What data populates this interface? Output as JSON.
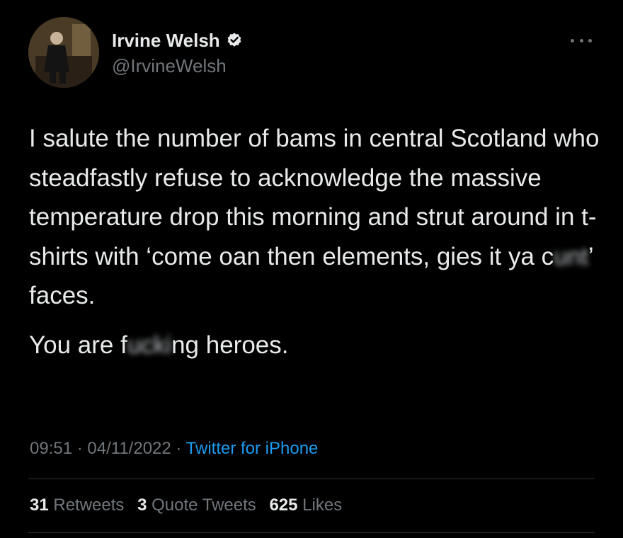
{
  "user": {
    "display_name": "Irvine Welsh",
    "handle": "@IrvineWelsh",
    "verified_icon": "verified-badge-icon",
    "avatar_icon": "profile-avatar"
  },
  "tweet": {
    "paragraph1": {
      "part1": "I salute the number of bams in central Scotland who steadfastly refuse to acknowledge the massive temperature drop this morning and strut around in t-shirts with ‘come oan then elements, gies it ya c",
      "censored": "unt",
      "part2": "’ faces."
    },
    "paragraph2": {
      "part1": "You are f",
      "censored": "ucki",
      "part2": "ng heroes."
    }
  },
  "meta": {
    "time": "09:51",
    "separator": "·",
    "date": "04/11/2022",
    "source": "Twitter for iPhone"
  },
  "stats": {
    "retweets_count": "31",
    "retweets_label": "Retweets",
    "quotes_count": "3",
    "quotes_label": "Quote Tweets",
    "likes_count": "625",
    "likes_label": "Likes"
  },
  "colors": {
    "background": "#000000",
    "text": "#e7e9ea",
    "secondary": "#71767b",
    "link": "#1d9bf0",
    "divider": "#2f3336"
  }
}
